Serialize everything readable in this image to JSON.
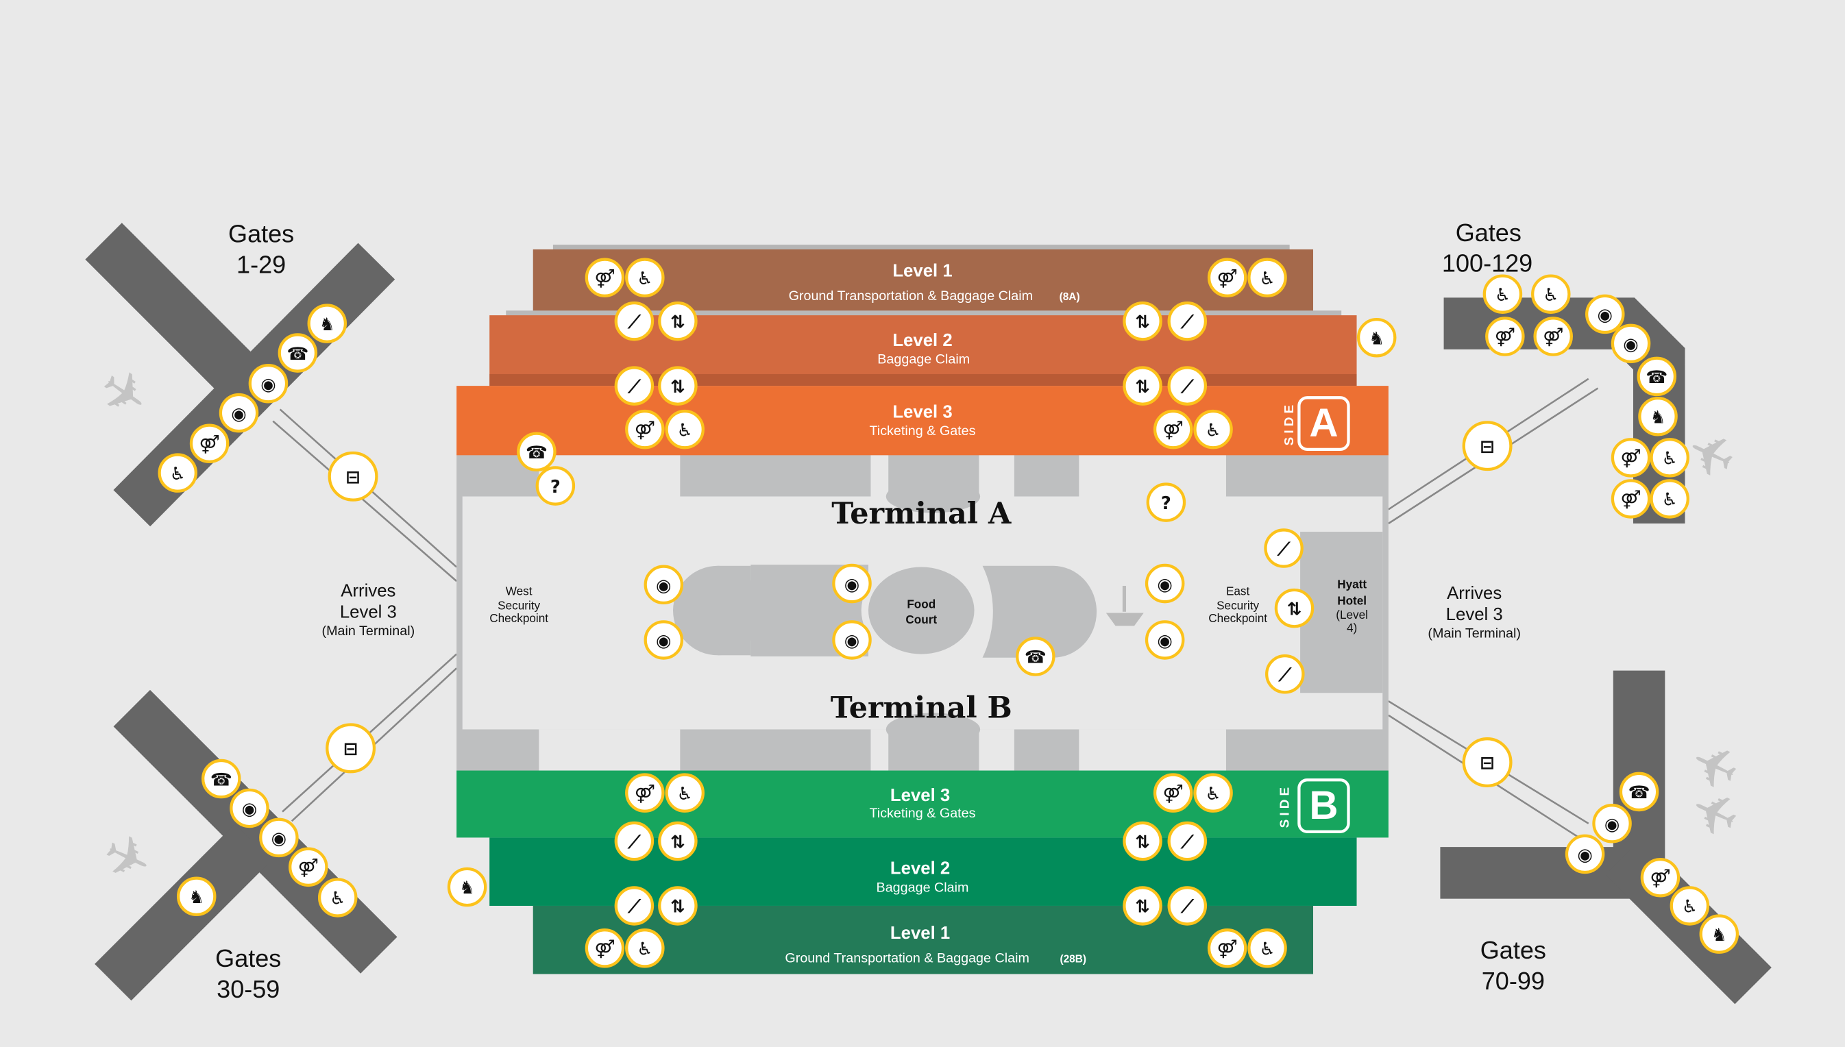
{
  "colors": {
    "background": "#e9e9e9",
    "level1_a": "#a5694b",
    "level2_a": "#d36a40",
    "level3_a": "#ed7033",
    "level3_b": "#17a55e",
    "level2_b": "#028c5a",
    "level1_b": "#237b58",
    "concourse": "#666666",
    "building": "#bebfc0",
    "icon_ring": "#fcc21b"
  },
  "side_a": {
    "side_label": "SIDE",
    "letter": "A",
    "level1": {
      "title": "Level 1",
      "subtitle": "Ground Transportation & Baggage Claim",
      "tag": "(8A)"
    },
    "level2": {
      "title": "Level 2",
      "subtitle": "Baggage Claim"
    },
    "level3": {
      "title": "Level 3",
      "subtitle": "Ticketing & Gates"
    }
  },
  "side_b": {
    "side_label": "SIDE",
    "letter": "B",
    "level3": {
      "title": "Level 3",
      "subtitle": "Ticketing & Gates"
    },
    "level2": {
      "title": "Level 2",
      "subtitle": "Baggage Claim"
    },
    "level1": {
      "title": "Level 1",
      "subtitle": "Ground Transportation & Baggage Claim",
      "tag": "(28B)"
    }
  },
  "terminal": {
    "terminal_a": "Terminal A",
    "terminal_b": "Terminal B",
    "food_court": [
      "Food",
      "Court"
    ],
    "west_checkpoint": [
      "West",
      "Security",
      "Checkpoint"
    ],
    "east_checkpoint": [
      "East",
      "Security",
      "Checkpoint"
    ],
    "hotel": [
      "Hyatt",
      "Hotel",
      "(Level",
      "4)"
    ]
  },
  "gates": {
    "nw": [
      "Gates",
      "1-29"
    ],
    "sw": [
      "Gates",
      "30-59"
    ],
    "ne": [
      "Gates",
      "100-129"
    ],
    "se": [
      "Gates",
      "70-99"
    ]
  },
  "arrivals": {
    "west": [
      "Arrives",
      "Level 3",
      "(Main Terminal)"
    ],
    "east": [
      "Arrives",
      "Level 3",
      "(Main Terminal)"
    ]
  },
  "icons": {
    "restroom": {
      "name": "restroom-icon",
      "glyph": "⚤"
    },
    "accessible": {
      "name": "accessible-icon",
      "glyph": "♿"
    },
    "escalator": {
      "name": "escalator-icon",
      "glyph": "⟋"
    },
    "elevator": {
      "name": "elevator-icon",
      "glyph": "⇅"
    },
    "phone": {
      "name": "phone-icon",
      "glyph": "☎"
    },
    "info": {
      "name": "information-icon",
      "glyph": "?"
    },
    "eye": {
      "name": "eye-icon",
      "glyph": "◉"
    },
    "dog": {
      "name": "service-dog-icon",
      "glyph": "♞"
    },
    "train": {
      "name": "train-icon",
      "glyph": "⊟"
    },
    "plane": {
      "name": "airplane-icon",
      "glyph": "✈"
    }
  }
}
